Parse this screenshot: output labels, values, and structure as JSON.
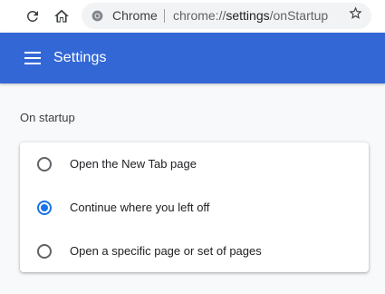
{
  "browser": {
    "origin_chip": "Chrome",
    "url_scheme": "chrome://",
    "url_host": "settings",
    "url_path": "/onStartup"
  },
  "header": {
    "title": "Settings"
  },
  "section": {
    "title": "On startup",
    "options": [
      {
        "label": "Open the New Tab page",
        "checked": false
      },
      {
        "label": "Continue where you left off",
        "checked": true
      },
      {
        "label": "Open a specific page or set of pages",
        "checked": false
      }
    ]
  },
  "colors": {
    "header_bg": "#3367d6",
    "accent": "#1a73e8",
    "page_bg": "#f8f9fa"
  },
  "icons": {
    "reload": "reload-icon",
    "home": "home-icon",
    "site": "chrome-icon",
    "bookmark": "star-icon",
    "menu": "hamburger-menu-icon"
  }
}
